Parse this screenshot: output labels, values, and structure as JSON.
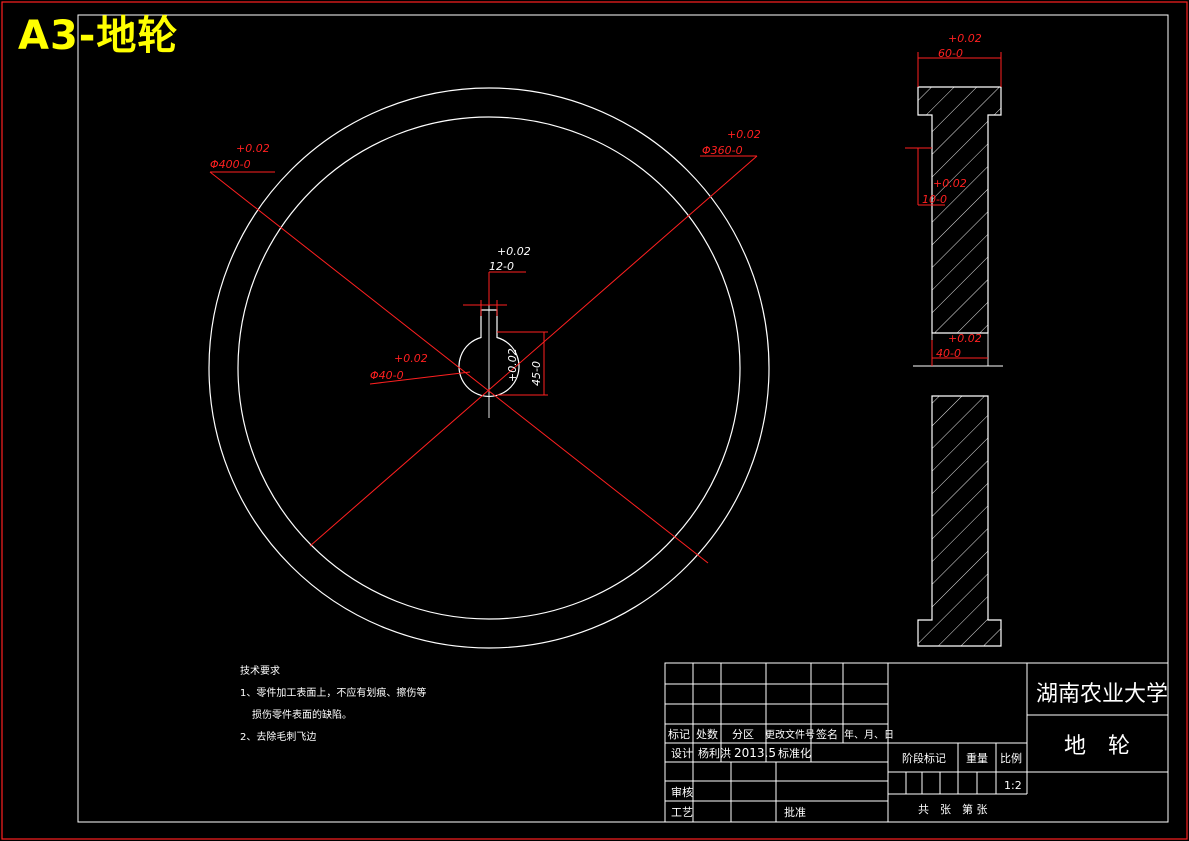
{
  "banner": "A3-地轮",
  "front_view": {
    "dim_outer": {
      "tol": "+0.02",
      "value": "Φ400-0"
    },
    "dim_rim": {
      "tol": "+0.02",
      "value": "Φ360-0"
    },
    "dim_key_width": {
      "tol": "+0.02",
      "value": "12-0"
    },
    "dim_bore": {
      "tol": "+0.02",
      "value": "Φ40-0"
    },
    "dim_key_depth": {
      "tol": "+0.02",
      "value": "45-0"
    }
  },
  "section_view": {
    "dim_width": {
      "tol": "+0.02",
      "value": "60-0"
    },
    "dim_web": {
      "tol": "+0.02",
      "value": "10-0"
    },
    "dim_hub": {
      "tol": "+0.02",
      "value": "40-0"
    }
  },
  "notes": {
    "title": "技术要求",
    "line1": "1、零件加工表面上，不应有划痕、擦伤等",
    "line2": "损伤零件表面的缺陷。",
    "line3": "2、去除毛刺飞边"
  },
  "title_block": {
    "university": "湖南农业大学",
    "part_name": "地　轮",
    "rev_headers": [
      "标记",
      "处数",
      "分区",
      "更改文件号",
      "签名",
      "年、月、日"
    ],
    "design_label": "设计",
    "designer": "杨利洪",
    "date": "2013.5",
    "standard": "标准化",
    "review": "审核",
    "process": "工艺",
    "approve": "批准",
    "stage": "阶段标记",
    "weight": "重量",
    "scale_label": "比例",
    "scale": "1:2",
    "sheets": "共　张　第 张"
  },
  "colors": {
    "background": "#000000",
    "outline": "#ffffff",
    "dimension": "#ff0000",
    "banner": "#ffff00",
    "border": "#ff0000"
  }
}
